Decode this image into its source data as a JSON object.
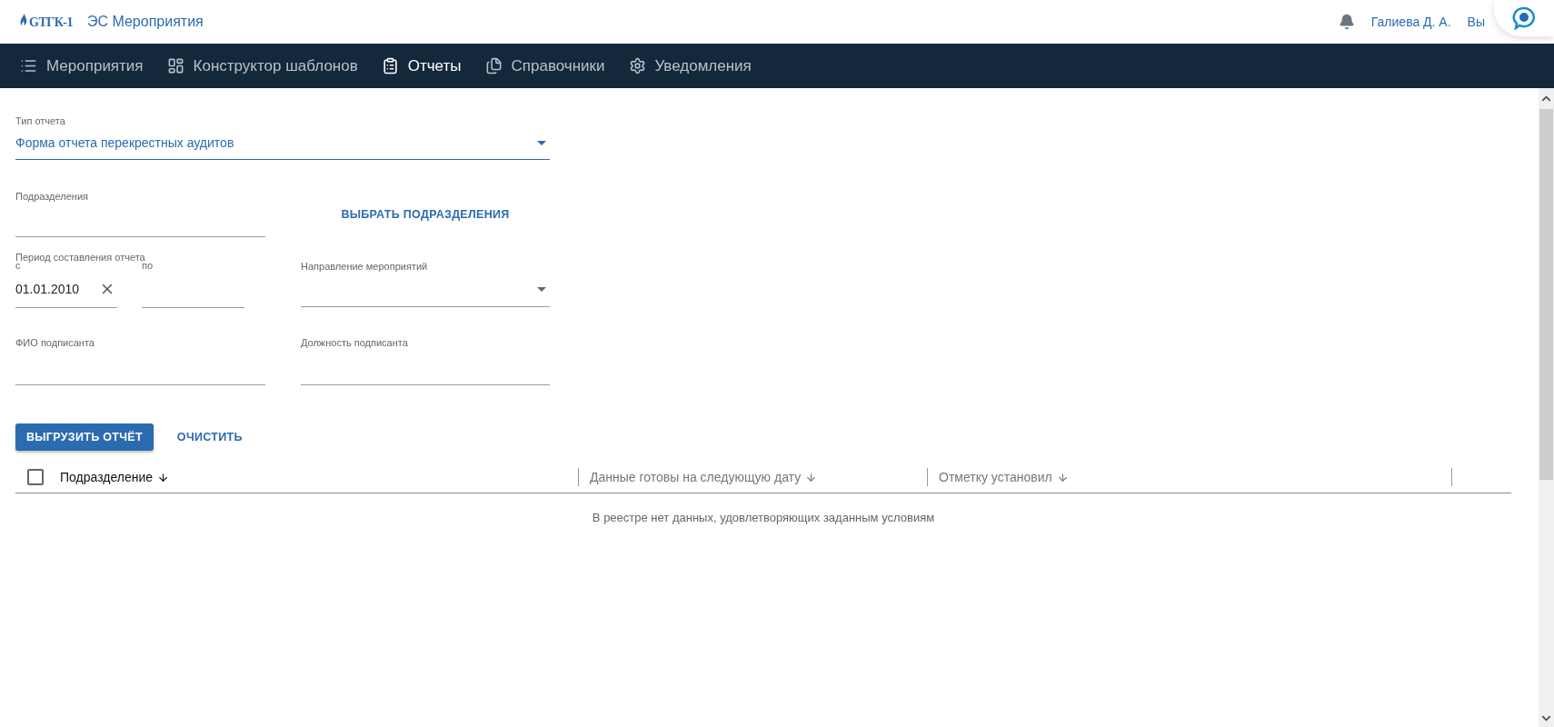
{
  "header": {
    "logo_text": "GТГК-1",
    "app_title": "ЭС Мероприятия",
    "user": "Галиева Д. А.",
    "logout": "Вы"
  },
  "nav": [
    {
      "label": "Мероприятия",
      "kind": "list",
      "selected": false
    },
    {
      "label": "Конструктор шаблонов",
      "kind": "dashboard",
      "selected": false
    },
    {
      "label": "Отчеты",
      "kind": "clipboard",
      "selected": true
    },
    {
      "label": "Справочники",
      "kind": "files",
      "selected": false
    },
    {
      "label": "Уведомления",
      "kind": "gear",
      "selected": false
    }
  ],
  "form": {
    "report_type": {
      "label": "Тип отчета",
      "value": "Форма отчета перекрестных аудитов"
    },
    "divisions": {
      "label": "Подразделения",
      "button": "ВЫБРАТЬ ПОДРАЗДЕЛЕНИЯ"
    },
    "period": {
      "label": "Период составления отчета",
      "from_label": "с",
      "from_value": "01.01.2010",
      "to_label": "по"
    },
    "direction": {
      "label": "Направление мероприятий"
    },
    "signer_name": {
      "label": "ФИО подписанта"
    },
    "signer_position": {
      "label": "Должность подписанта"
    }
  },
  "actions": {
    "export": "ВЫГРУЗИТЬ ОТЧЁТ",
    "clear": "ОЧИСТИТЬ"
  },
  "table": {
    "select_all_checked": false,
    "columns": [
      {
        "label": "Подразделение",
        "active": true
      },
      {
        "label": "Данные готовы на следующую дату",
        "active": false
      },
      {
        "label": "Отметку установил",
        "active": false
      }
    ],
    "empty_text": "В реестре нет данных, удовлетворяющих заданным условиям"
  }
}
